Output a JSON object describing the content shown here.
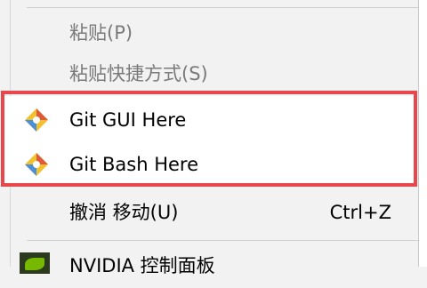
{
  "context_menu": {
    "items": [
      {
        "label": "粘贴(P)"
      },
      {
        "label": "粘贴快捷方式(S)"
      },
      {
        "label": "Git GUI Here"
      },
      {
        "label": "Git Bash Here"
      },
      {
        "label": "撤消 移动(U)",
        "shortcut": "Ctrl+Z"
      },
      {
        "label": "NVIDIA 控制面板"
      }
    ]
  },
  "colors": {
    "highlight_border": "#e8474c",
    "git_icon_red": "#e05a3a",
    "git_icon_blue": "#4a8fd8",
    "git_icon_yellow": "#f2c12e",
    "nvidia_green": "#76b900"
  },
  "icons": [
    "git-gui-icon",
    "git-bash-icon",
    "nvidia-icon"
  ]
}
